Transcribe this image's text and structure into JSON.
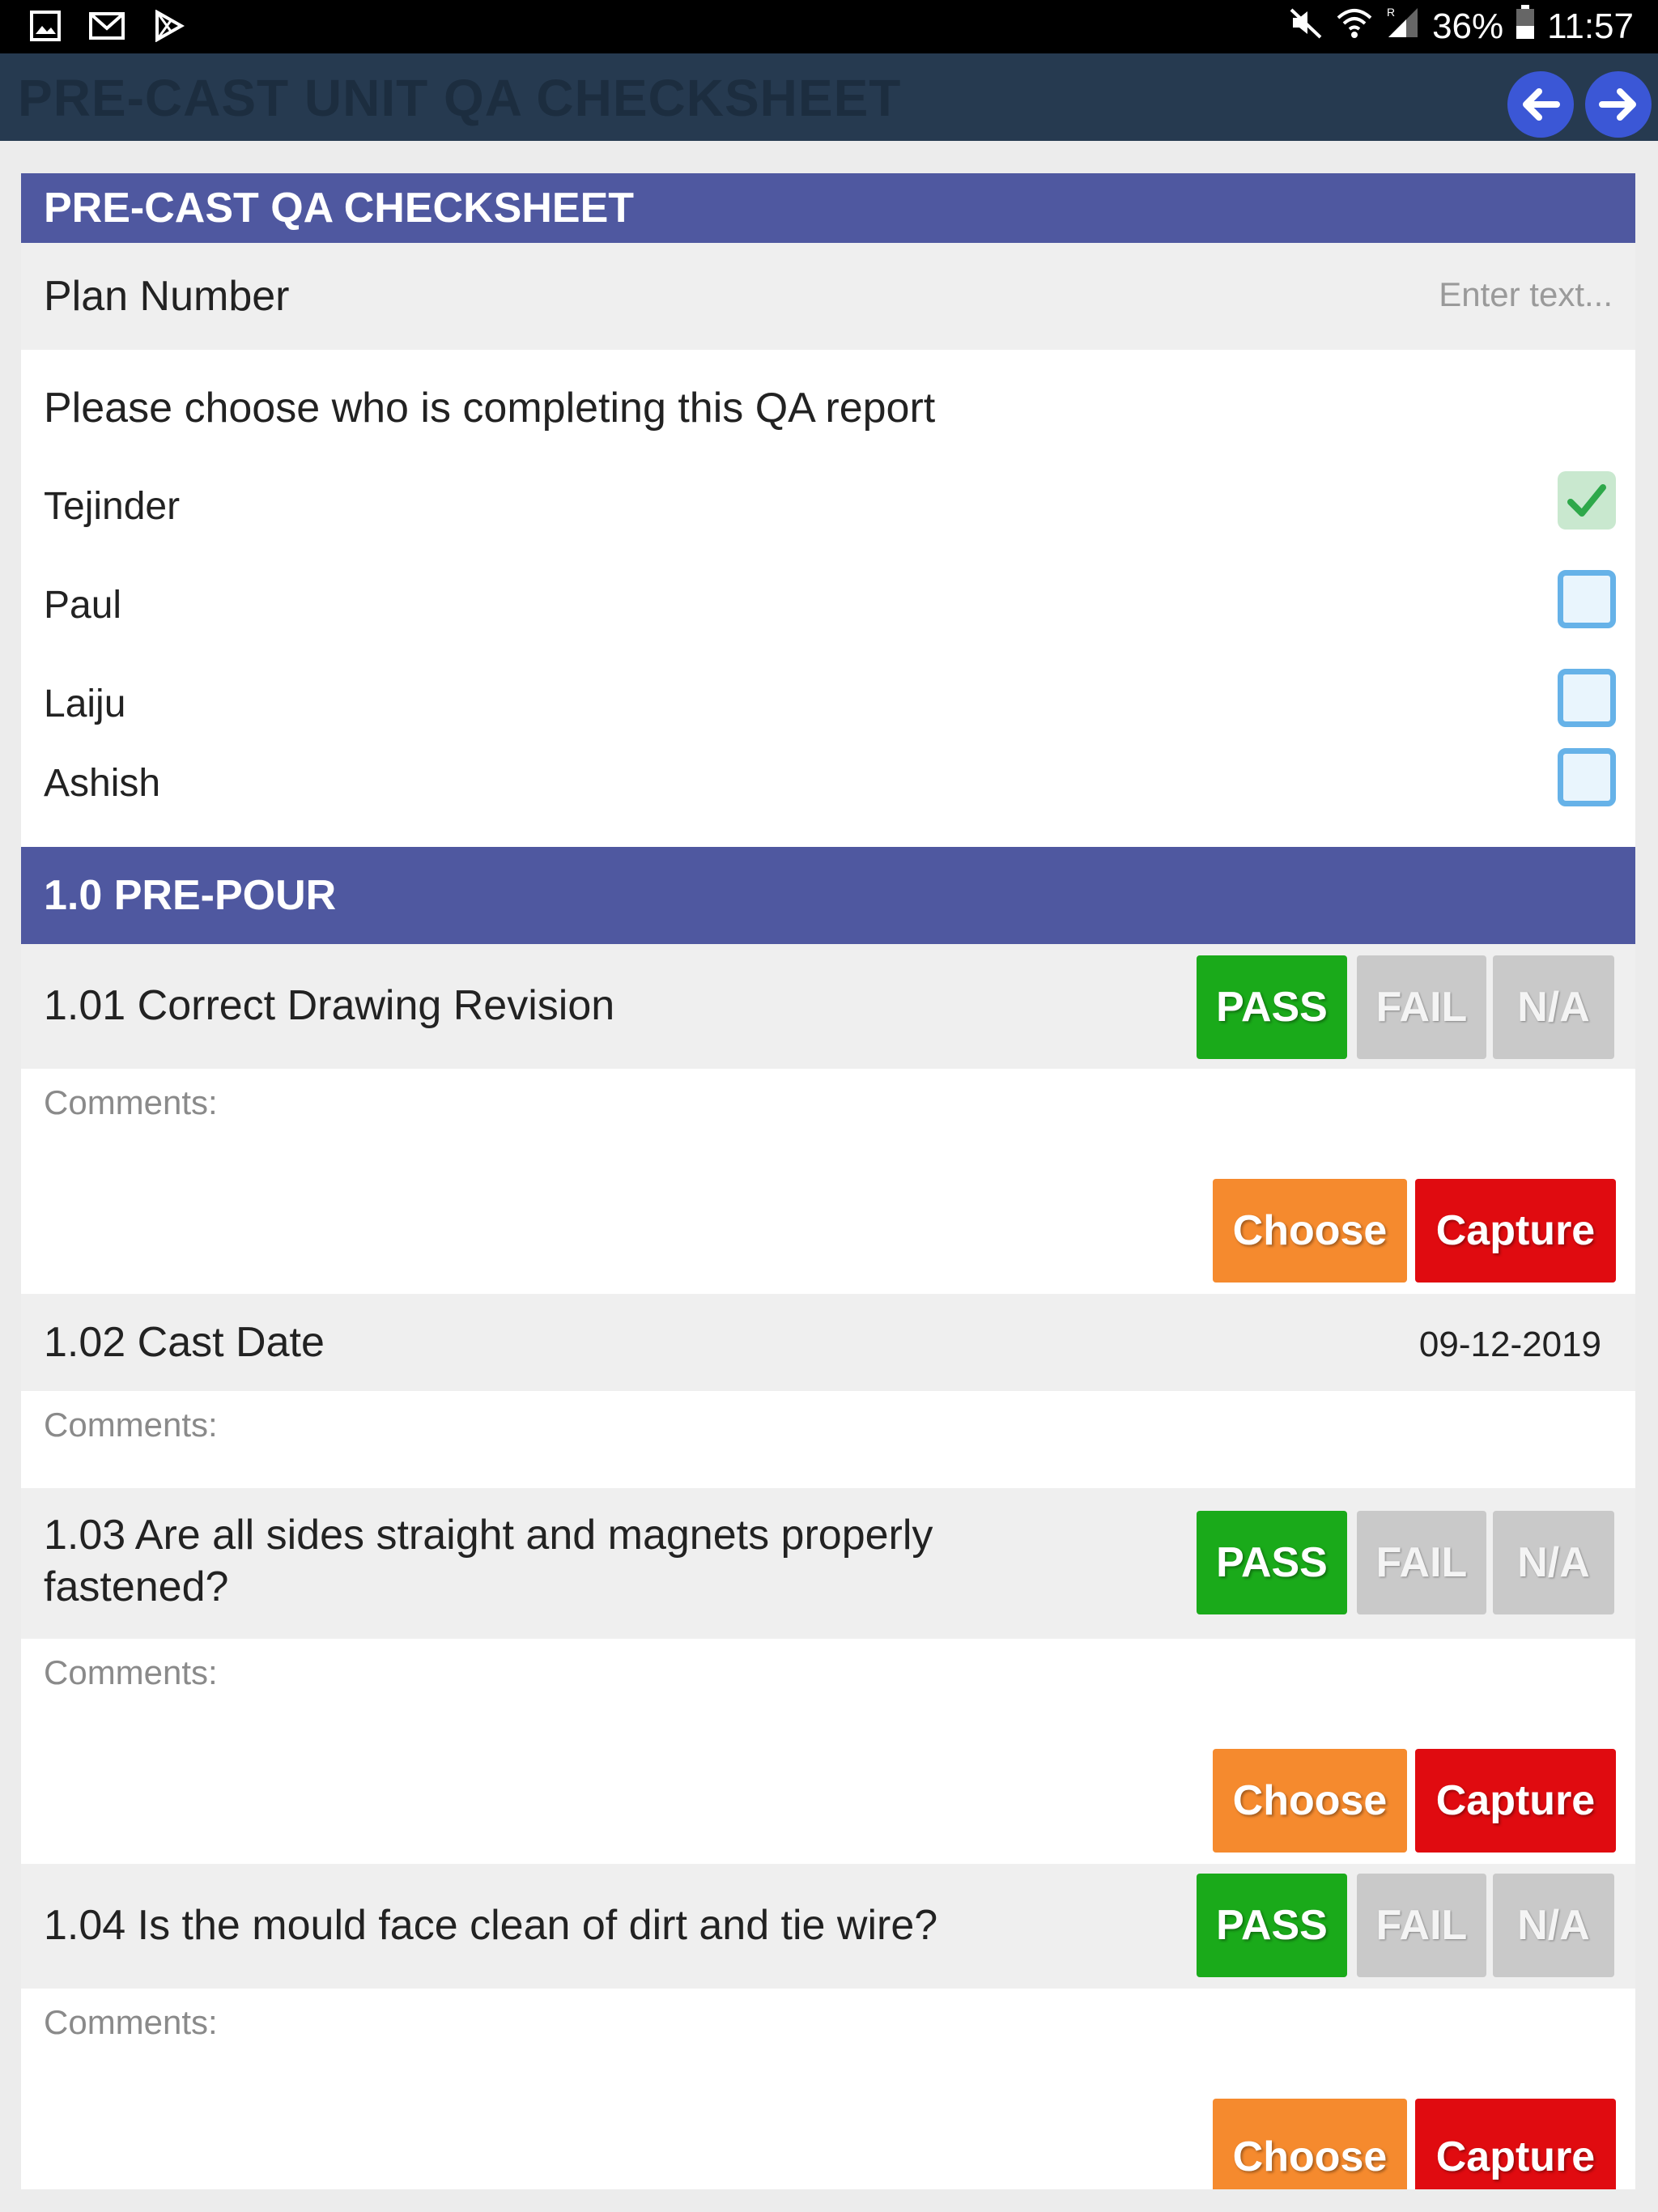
{
  "status_bar": {
    "battery": "36%",
    "time": "11:57",
    "notif_icons": [
      "gallery-icon",
      "gmail-icon",
      "play-store-icon"
    ],
    "system_icons": [
      "mute-icon",
      "wifi-icon",
      "signal-icon",
      "battery-icon"
    ]
  },
  "app_bar": {
    "title": "PRE-CAST UNIT QA CHECKSHEET"
  },
  "form": {
    "header": "PRE-CAST QA CHECKSHEET",
    "plan_number": {
      "label": "Plan Number",
      "placeholder": "Enter text..."
    },
    "completer": {
      "question": "Please choose who is completing this QA report",
      "options": [
        {
          "name": "Tejinder",
          "checked": true
        },
        {
          "name": "Paul",
          "checked": false
        },
        {
          "name": "Laiju",
          "checked": false
        },
        {
          "name": "Ashish",
          "checked": false
        }
      ]
    },
    "section": "1.0 PRE-POUR",
    "items": [
      {
        "label": "1.01 Correct Drawing Revision",
        "result": "PASS"
      },
      {
        "label": "1.02 Cast Date",
        "value": "09-12-2019"
      },
      {
        "label": "1.03 Are all sides straight and magnets properly fastened?",
        "result": "PASS"
      },
      {
        "label": "1.04 Is the mould face clean of dirt and tie wire?",
        "result": "PASS"
      }
    ],
    "buttons": {
      "pass": "PASS",
      "fail": "FAIL",
      "na": "N/A",
      "choose": "Choose",
      "capture": "Capture"
    },
    "comments_label": "Comments:"
  },
  "colors": {
    "section_header": "#4f58a0",
    "pass": "#1aaa1a",
    "choose": "#f58a2e",
    "capture": "#e00b10",
    "nav_button": "#3b57d6"
  }
}
